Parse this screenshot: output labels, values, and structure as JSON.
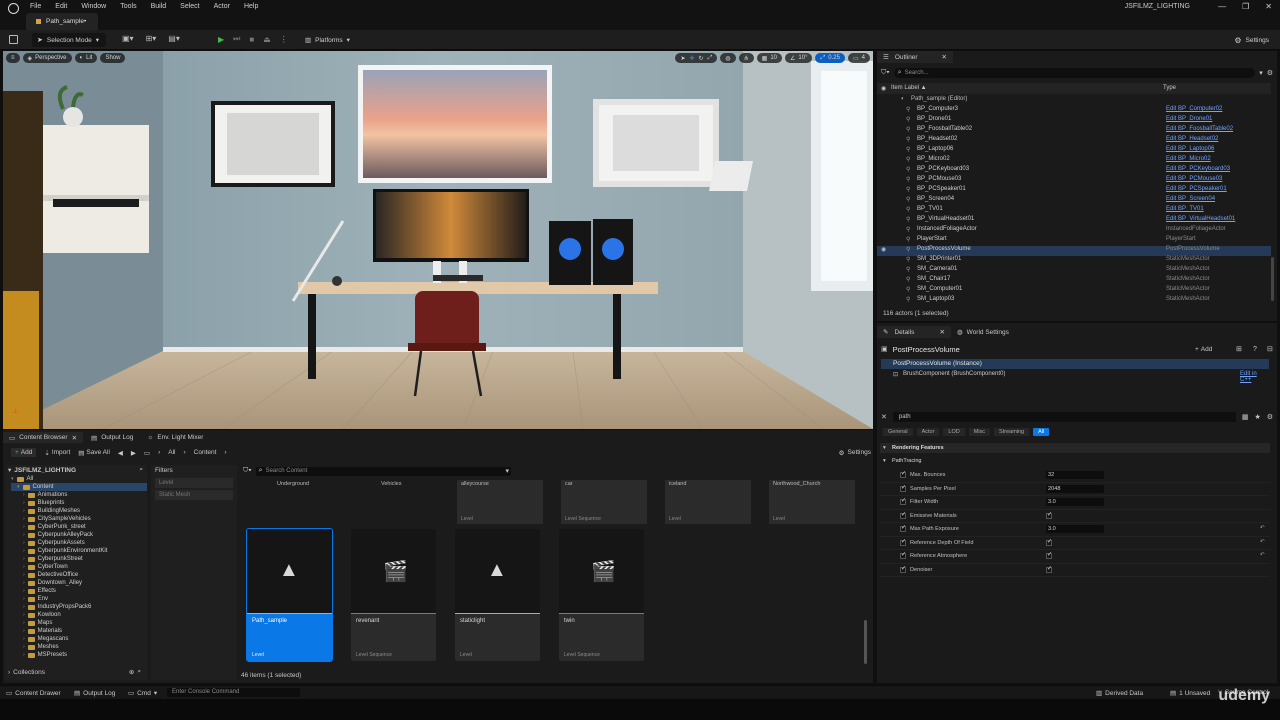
{
  "app": {
    "menu": [
      "File",
      "Edit",
      "Window",
      "Tools",
      "Build",
      "Select",
      "Actor",
      "Help"
    ],
    "doc_tab": "Path_sample•",
    "project": "JSFILMZ_LIGHTING"
  },
  "toolbar": {
    "mode": "Selection Mode",
    "platforms": "Platforms",
    "settings": "Settings"
  },
  "viewport": {
    "perspective": "Perspective",
    "lit": "Lit",
    "show": "Show",
    "grid_snap": "10",
    "rot_snap": "10°",
    "scale_snap": "0.25",
    "cam_speed": "4"
  },
  "outliner": {
    "tab": "Outliner",
    "search_placeholder": "Search...",
    "col_label": "Item Label ▲",
    "col_type": "Type",
    "root": "Path_sample (Editor)",
    "rows": [
      {
        "label": "BP_Computer3",
        "type": "Edit BP_Computer02",
        "link": true
      },
      {
        "label": "BP_Drone01",
        "type": "Edit BP_Drone01",
        "link": true
      },
      {
        "label": "BP_FoosballTable02",
        "type": "Edit BP_FoosballTable02",
        "link": true
      },
      {
        "label": "BP_Headset02",
        "type": "Edit BP_Headset02",
        "link": true
      },
      {
        "label": "BP_Laptop06",
        "type": "Edit BP_Laptop06",
        "link": true
      },
      {
        "label": "BP_Micro02",
        "type": "Edit BP_Micro02",
        "link": true
      },
      {
        "label": "BP_PCKeyboard03",
        "type": "Edit BP_PCKeyboard03",
        "link": true
      },
      {
        "label": "BP_PCMouse03",
        "type": "Edit BP_PCMouse03",
        "link": true
      },
      {
        "label": "BP_PCSpeaker01",
        "type": "Edit BP_PCSpeaker01",
        "link": true
      },
      {
        "label": "BP_Screen04",
        "type": "Edit BP_Screen04",
        "link": true
      },
      {
        "label": "BP_TV01",
        "type": "Edit BP_TV01",
        "link": true
      },
      {
        "label": "BP_VirtualHeadset01",
        "type": "Edit BP_VirtualHeadset01",
        "link": true
      },
      {
        "label": "InstancedFoliageActor",
        "type": "InstancedFoliageActor",
        "link": false
      },
      {
        "label": "PlayerStart",
        "type": "PlayerStart",
        "link": false
      },
      {
        "label": "PostProcessVolume",
        "type": "PostProcessVolume",
        "link": false,
        "selected": true
      },
      {
        "label": "SM_3DPrinter01",
        "type": "StaticMeshActor",
        "link": false
      },
      {
        "label": "SM_Camera01",
        "type": "StaticMeshActor",
        "link": false
      },
      {
        "label": "SM_Chair17",
        "type": "StaticMeshActor",
        "link": false
      },
      {
        "label": "SM_Computer01",
        "type": "StaticMeshActor",
        "link": false
      },
      {
        "label": "SM_Laptop03",
        "type": "StaticMeshActor",
        "link": false
      }
    ],
    "footer": "116 actors (1 selected)"
  },
  "details": {
    "tab": "Details",
    "tab2": "World Settings",
    "actor": "PostProcessVolume",
    "add": "Add",
    "instance": "PostProcessVolume (Instance)",
    "component": "BrushComponent (BrushComponent0)",
    "edit_cpp": "Edit in C++",
    "search_value": "path",
    "filters": [
      "General",
      "Actor",
      "LOD",
      "Misc",
      "Streaming",
      "All"
    ],
    "section": "Rendering Features",
    "subsection": "PathTracing",
    "props": [
      {
        "label": "Max. Bounces",
        "value": "32",
        "kind": "num",
        "reset": false
      },
      {
        "label": "Samples Per Pixel",
        "value": "2048",
        "kind": "num",
        "reset": false
      },
      {
        "label": "Filter Width",
        "value": "3.0",
        "kind": "num",
        "reset": false
      },
      {
        "label": "Emissive Materials",
        "value": "",
        "kind": "check",
        "reset": false
      },
      {
        "label": "Max Path Exposure",
        "value": "3.0",
        "kind": "num",
        "reset": true
      },
      {
        "label": "Reference Depth Of Field",
        "value": "",
        "kind": "check",
        "reset": true
      },
      {
        "label": "Reference Atmosphere",
        "value": "",
        "kind": "check",
        "reset": true
      },
      {
        "label": "Denoiser",
        "value": "",
        "kind": "check",
        "reset": false
      }
    ]
  },
  "content_browser": {
    "tabs": [
      "Content Browser",
      "Output Log",
      "Env. Light Mixer"
    ],
    "add": "Add",
    "import": "Import",
    "save_all": "Save All",
    "path": [
      "All",
      "Content"
    ],
    "settings": "Settings",
    "project_root": "JSFILMZ_LIGHTING",
    "tree": [
      "All",
      "Content",
      "Animations",
      "Blueprints",
      "BuildingMeshes",
      "CitySampleVehicles",
      "CyberPunk_street",
      "CyberpunkAlleyPack",
      "CyberpunkAssets",
      "CyberpunkEnvironmentKit",
      "CyberpunkStreet",
      "CyberTown",
      "DetectiveOffice",
      "Downtown_Alley",
      "Effects",
      "Env",
      "IndustryPropsPack6",
      "Kowloon",
      "Maps",
      "Materials",
      "Megascans",
      "Meshes",
      "MSPresets"
    ],
    "filters_label": "Filters",
    "filter_chips": [
      "Level",
      "Static Mesh"
    ],
    "search_placeholder": "Search Content",
    "top_row": [
      {
        "name": "Underground",
        "kind": ""
      },
      {
        "name": "Vehicles",
        "kind": ""
      },
      {
        "name": "alleycourse",
        "kind": "Level"
      },
      {
        "name": "car",
        "kind": "Level Sequence"
      },
      {
        "name": "iceland",
        "kind": "Level"
      },
      {
        "name": "Northwood_Church",
        "kind": "Level"
      }
    ],
    "tiles": [
      {
        "name": "Path_sample",
        "kind": "Level",
        "icon": "level",
        "selected": true
      },
      {
        "name": "revenant",
        "kind": "Level Sequence",
        "icon": "sequence",
        "selected": false
      },
      {
        "name": "staticlight",
        "kind": "Level",
        "icon": "level",
        "selected": false
      },
      {
        "name": "twin",
        "kind": "Level Sequence",
        "icon": "sequence",
        "selected": false
      }
    ],
    "count": "46 items (1 selected)",
    "collections": "Collections"
  },
  "status": {
    "content_drawer": "Content Drawer",
    "output_log": "Output Log",
    "cmd": "Cmd",
    "console_placeholder": "Enter Console Command",
    "derived": "Derived Data",
    "unsaved": "1 Unsaved",
    "source_control": "Source Control",
    "watermark": "udemy"
  },
  "colors": {
    "accent": "#0a78e6",
    "selection": "#243a58",
    "link": "#6da4ff",
    "folder": "#c79a3d",
    "play": "#3fbd3f"
  }
}
